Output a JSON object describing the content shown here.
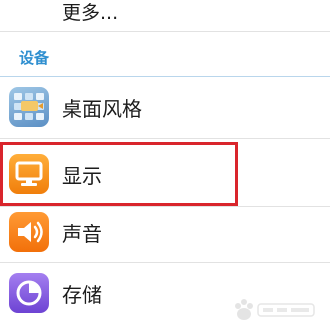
{
  "more": {
    "label": "更多..."
  },
  "section": {
    "title": "设备"
  },
  "items": [
    {
      "label": "桌面风格",
      "icon": "theme-icon"
    },
    {
      "label": "显示",
      "icon": "monitor-icon"
    },
    {
      "label": "声音",
      "icon": "speaker-icon"
    },
    {
      "label": "存储",
      "icon": "storage-pie-icon"
    }
  ],
  "colors": {
    "section_header": "#2f8fd0",
    "highlight_border": "#d9252c",
    "display_icon": "#f5921e",
    "sound_icon": "#f5831f",
    "storage_icon": "#7b53df"
  }
}
